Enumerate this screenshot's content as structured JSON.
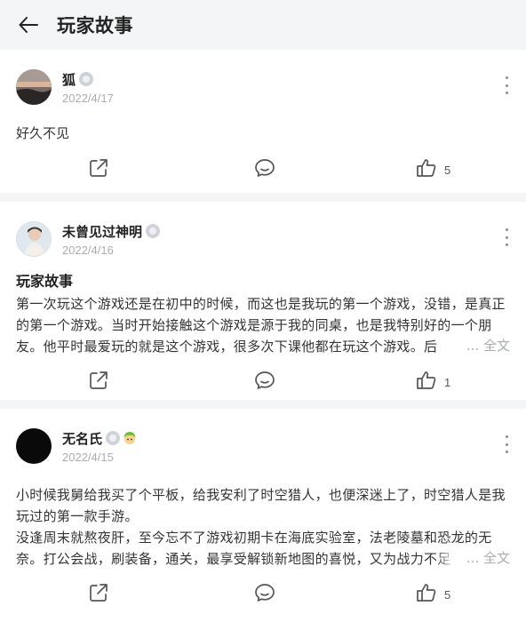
{
  "header": {
    "title": "玩家故事"
  },
  "posts": [
    {
      "author": "狐",
      "date": "2022/4/17",
      "content": "好久不见",
      "likes": "5"
    },
    {
      "author": "未曾见过神明",
      "date": "2022/4/16",
      "title": "玩家故事",
      "body": "第一次玩这个游戏还是在初中的时候，而这也是我玩的第一个游戏，没错，是真正的第一个游戏。当时开始接触这个游戏是源于我的同桌，也是我特别好的一个朋友。他平时最爱玩的就是这个游戏，很多次下课他都在玩这个游戏。后",
      "full_text_label": "... 全文",
      "likes": "1"
    },
    {
      "author": "无名氏",
      "date": "2022/4/15",
      "body": "小时候我舅给我买了个平板，给我安利了时空猎人，也便深迷上了，时空猎人是我玩过的第一款手游。\n没逢周末就熬夜肝，至今忘不了游戏初期卡在海底实验室，法老陵墓和恐龙的无奈。打公会战，刷装备，通关，最享受解锁新地图的喜悦，又为战力不足",
      "full_text_label": "... 全文",
      "likes": "5"
    }
  ],
  "icons": {
    "back": "back-arrow-icon",
    "verified": "verified-badge-icon",
    "more": "more-vertical-icon",
    "share": "share-icon",
    "comment": "comment-icon",
    "like": "thumbs-up-icon",
    "emoji": "green-haired-face-emoji"
  },
  "colors": {
    "background": "#f4f5f7",
    "card": "#ffffff",
    "muted": "#a9adb3"
  }
}
